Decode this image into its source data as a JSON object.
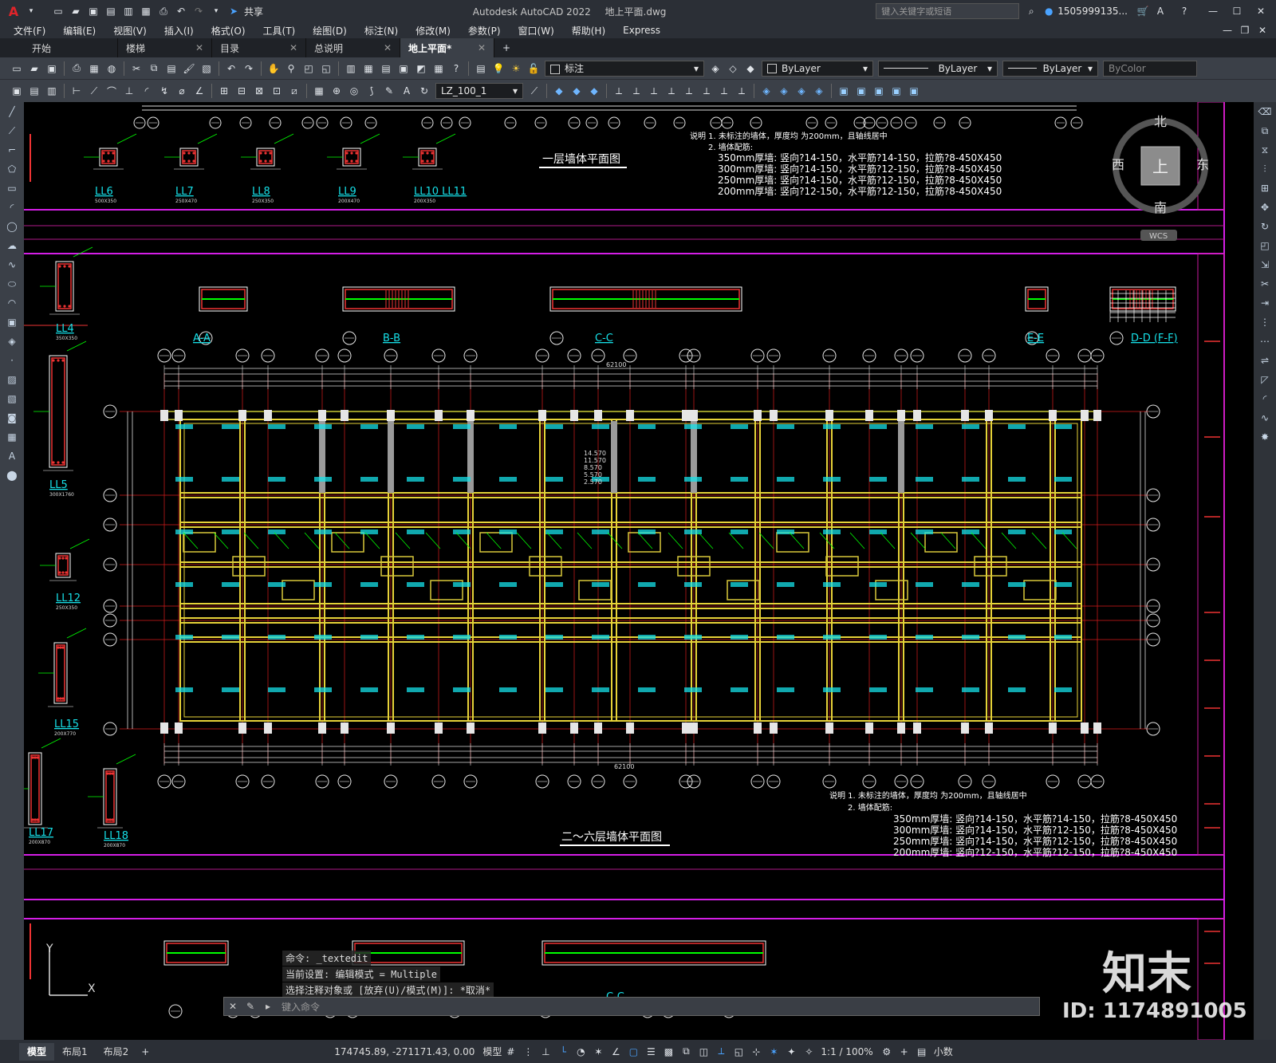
{
  "app": {
    "title": "Autodesk AutoCAD 2022",
    "filename": "地上平面.dwg",
    "search_placeholder": "键入关键字或短语",
    "user": "1505999135...",
    "share": "共享"
  },
  "menu": [
    "文件(F)",
    "编辑(E)",
    "视图(V)",
    "插入(I)",
    "格式(O)",
    "工具(T)",
    "绘图(D)",
    "标注(N)",
    "修改(M)",
    "参数(P)",
    "窗口(W)",
    "帮助(H)",
    "Express"
  ],
  "tabs": [
    {
      "label": "开始",
      "closable": false
    },
    {
      "label": "楼梯",
      "closable": true
    },
    {
      "label": "目录",
      "closable": true
    },
    {
      "label": "总说明",
      "closable": true
    },
    {
      "label": "地上平面*",
      "closable": true,
      "active": true
    }
  ],
  "toolbar": {
    "layer": "标注",
    "color": "ByLayer",
    "linetype": "ByLayer",
    "lineweight": "ByLayer",
    "plotstyle": "ByColor",
    "style_name": "LZ_100_1"
  },
  "viewcube": {
    "north": "北",
    "south": "南",
    "east": "东",
    "west": "西",
    "top": "上",
    "wcs": "WCS"
  },
  "drawing": {
    "plan1_title": "一层墙体平面图",
    "plan2_title": "二～六层墙体平面图",
    "notes1": [
      "说明  1. 未标注的墙体，厚度均       为200mm，且轴线居中",
      "2. 墙体配筋:",
      "350mm厚墙: 竖向?14-150，水平筋?14-150，拉筋?8-450X450",
      "300mm厚墙: 竖向?14-150，水平筋?12-150，拉筋?8-450X450",
      "250mm厚墙: 竖向?14-150，水平筋?12-150，拉筋?8-450X450",
      "200mm厚墙: 竖向?12-150，水平筋?12-150，拉筋?8-450X450"
    ],
    "notes2": [
      "说明  1. 未标注的墙体，厚度均       为200mm，且轴线居中",
      "2. 墙体配筋:",
      "350mm厚墙: 竖向?14-150，水平筋?14-150，拉筋?8-450X450",
      "300mm厚墙: 竖向?14-150，水平筋?12-150，拉筋?8-450X450",
      "250mm厚墙: 竖向?14-150，水平筋?12-150，拉筋?8-450X450",
      "200mm厚墙: 竖向?12-150，水平筋?12-150，拉筋?8-450X450"
    ],
    "top_beams": [
      "LL6",
      "LL7",
      "LL8",
      "LL9",
      "LL10 LL11"
    ],
    "top_beam_sizes": [
      "500X350",
      "250X470",
      "250X350",
      "200X470",
      "200X350\n200X370"
    ],
    "left_beams": [
      "LL4",
      "LL5",
      "LL12",
      "LL15",
      "LL17",
      "LL18"
    ],
    "left_beam_sizes": [
      "350X350",
      "300X1760",
      "250X350",
      "200X770",
      "200X870",
      "200X870"
    ],
    "sections": [
      "A-A",
      "B-B",
      "C-C",
      "E-E",
      "D-D (F-F)"
    ],
    "total_dim": "62100",
    "elev_list": [
      "14.570",
      "11.570",
      "8.570",
      "5.570",
      "2.570"
    ]
  },
  "command": {
    "line1": "命令: _textedit",
    "line2": "当前设置: 编辑模式 = Multiple",
    "line3": "选择注释对象或 [放弃(U)/模式(M)]: *取消*",
    "placeholder": "键入命令"
  },
  "status": {
    "tabs": [
      "模型",
      "布局1",
      "布局2"
    ],
    "coords": "174745.89, -271171.43, 0.00",
    "model": "模型",
    "scale": "1:1 / 100%",
    "units": "小数"
  },
  "watermark": {
    "brand": "知末",
    "id": "ID: 1174891005"
  }
}
